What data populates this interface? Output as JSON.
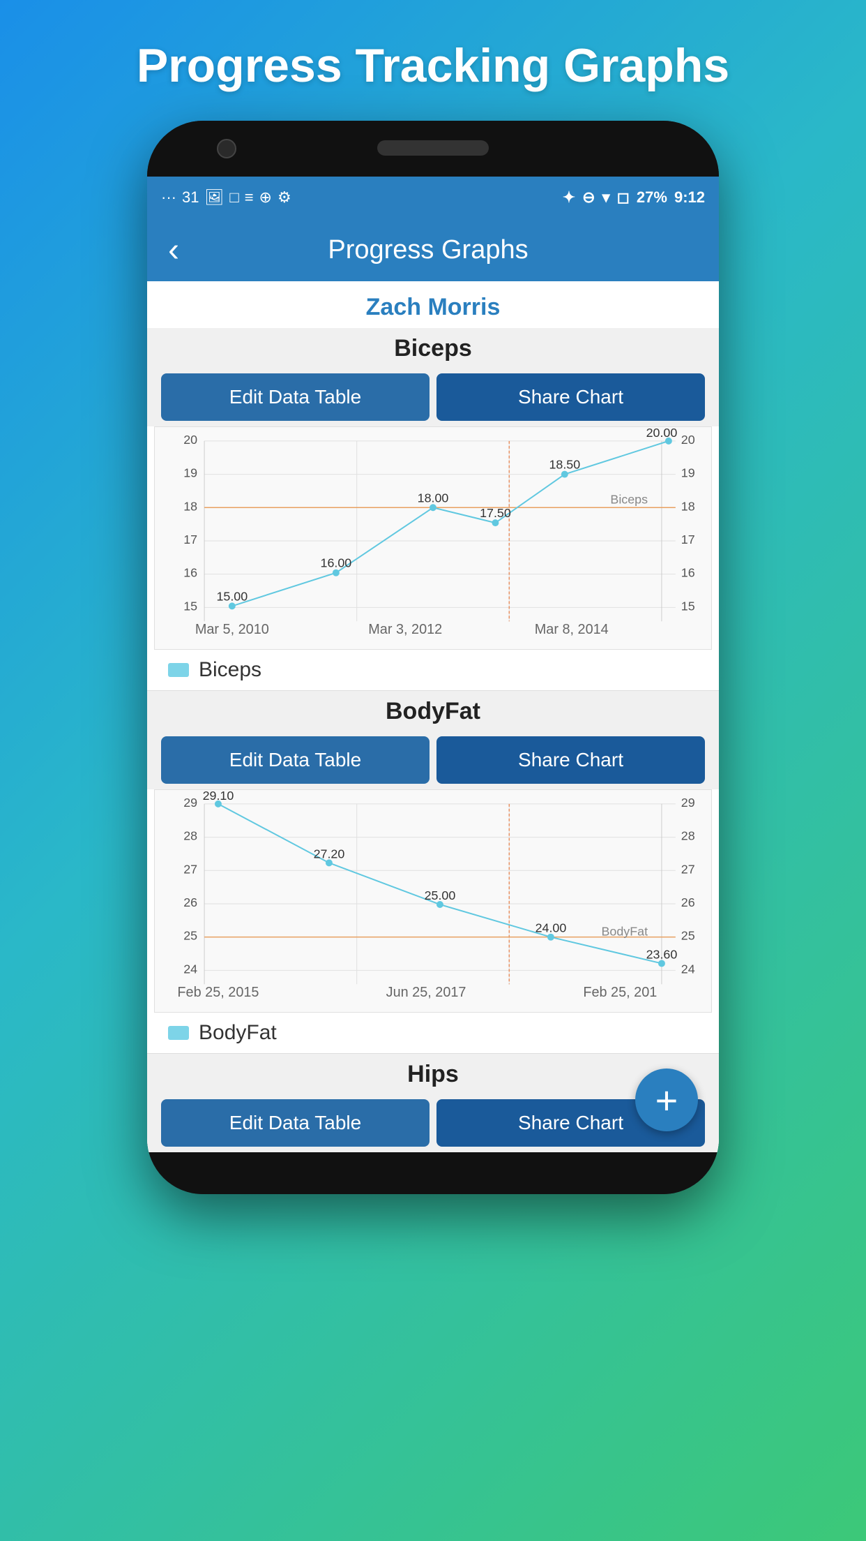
{
  "page": {
    "title": "Progress Tracking Graphs"
  },
  "status_bar": {
    "time": "9:12",
    "battery": "27%",
    "icons_left": [
      "...",
      "31",
      "🖼",
      "□",
      "📅",
      "🌐",
      "⚙"
    ],
    "icons_right": [
      "bluetooth",
      "minus-circle",
      "wifi",
      "sim",
      "battery",
      "27%",
      "9:12"
    ]
  },
  "app_header": {
    "back_label": "‹",
    "title": "Progress Graphs"
  },
  "user": {
    "name": "Zach Morris"
  },
  "charts": [
    {
      "id": "biceps",
      "title": "Biceps",
      "edit_btn": "Edit Data Table",
      "share_btn": "Share Chart",
      "legend": "Biceps",
      "y_axis": [
        20,
        19,
        18,
        17,
        16,
        15
      ],
      "x_axis": [
        "Mar 5, 2010",
        "Mar 3, 2012",
        "Mar 8, 2014"
      ],
      "data_points": [
        {
          "x": 0.05,
          "y": 0.82,
          "label": "15.00"
        },
        {
          "x": 0.28,
          "y": 0.54,
          "label": "16.00"
        },
        {
          "x": 0.48,
          "y": 0.27,
          "label": "18.00"
        },
        {
          "x": 0.62,
          "y": 0.36,
          "label": "17.50"
        },
        {
          "x": 0.78,
          "y": 0.14,
          "label": "18.50"
        },
        {
          "x": 0.97,
          "y": 0.0,
          "label": "20.00"
        }
      ],
      "avg_line_y": 0.27
    },
    {
      "id": "bodyfat",
      "title": "BodyFat",
      "edit_btn": "Edit Data Table",
      "share_btn": "Share Chart",
      "legend": "BodyFat",
      "y_axis": [
        29,
        28,
        27,
        26,
        25,
        24
      ],
      "x_axis": [
        "Feb 25, 2015",
        "Jun 25, 2017",
        "Feb 25, 201"
      ],
      "data_points": [
        {
          "x": 0.03,
          "y": 0.0,
          "label": "29.10"
        },
        {
          "x": 0.28,
          "y": 0.33,
          "label": "27.20"
        },
        {
          "x": 0.5,
          "y": 0.67,
          "label": "25.00"
        },
        {
          "x": 0.72,
          "y": 0.86,
          "label": "24.00"
        },
        {
          "x": 0.97,
          "y": 0.97,
          "label": "23.60"
        }
      ],
      "avg_line_y": 0.72
    },
    {
      "id": "hips",
      "title": "Hips",
      "edit_btn": "Edit Data Table",
      "share_btn": "Share Chart"
    }
  ],
  "fab": {
    "label": "+"
  }
}
